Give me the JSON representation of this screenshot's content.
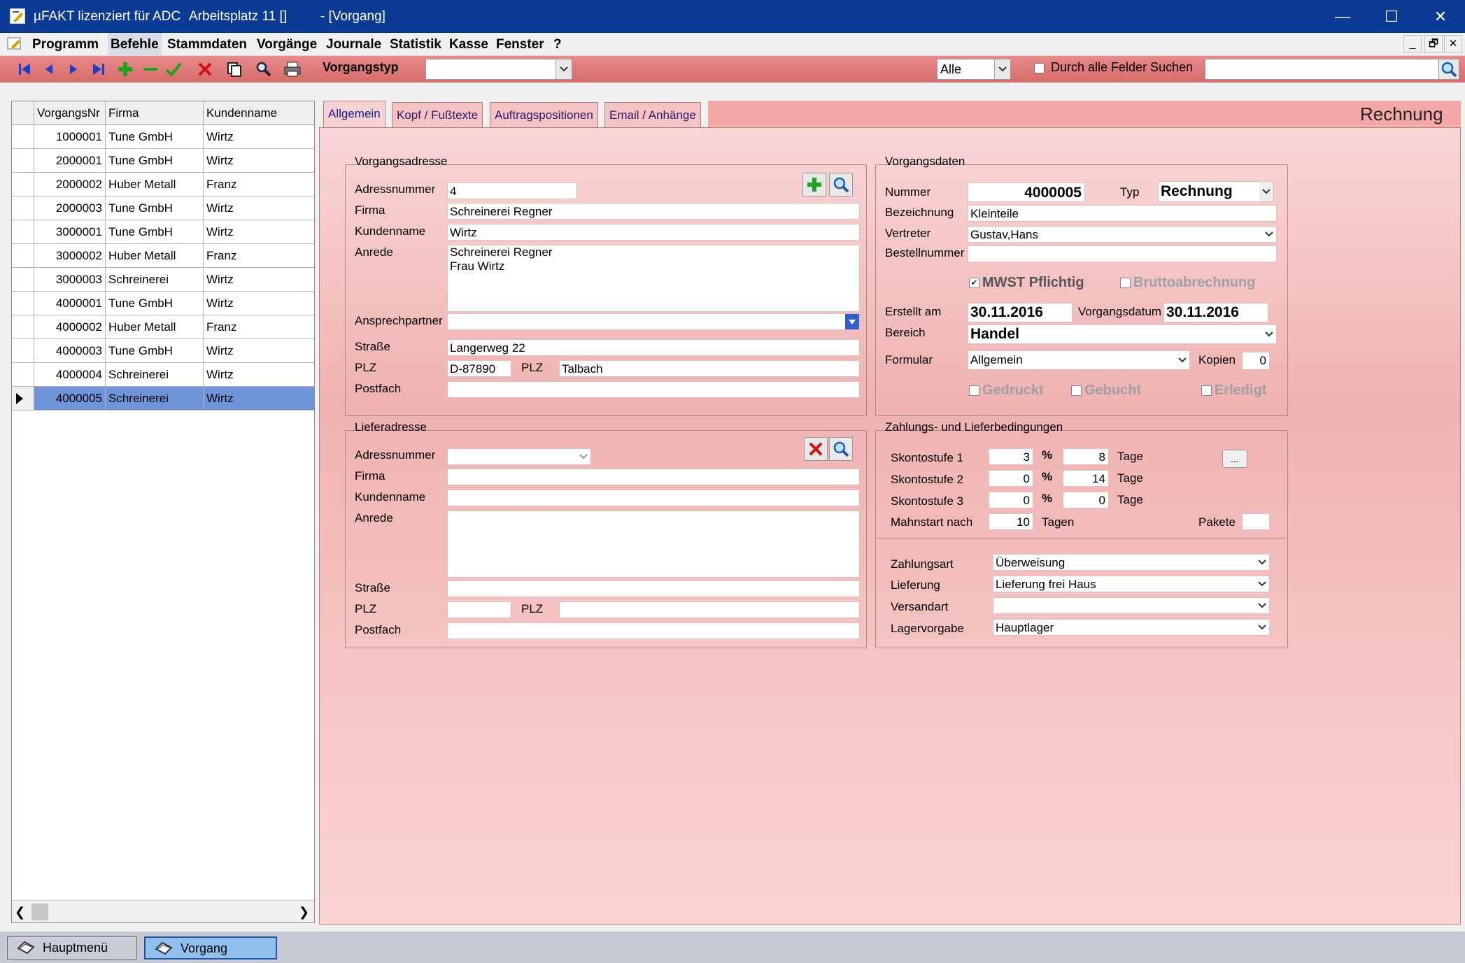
{
  "window": {
    "title": "µFAKT lizenziert für ADC",
    "workstation": "Arbeitsplatz 11 []",
    "doc": "- [Vorgang]",
    "minimize": "—",
    "maximize": "☐",
    "close": "✕"
  },
  "menu": [
    "Programm",
    "Befehle",
    "Stammdaten",
    "Vorgänge",
    "Journale",
    "Statistik",
    "Kasse",
    "Fenster",
    "?"
  ],
  "mdi": {
    "minimize": "_",
    "restore": "🗗",
    "close": "✕"
  },
  "toolbar": {
    "vorgangstyp_label": "Vorgangstyp",
    "vorgangstyp_value": "",
    "filter_value": "Alle",
    "search_all_label": "Durch alle Felder Suchen",
    "search_value": ""
  },
  "grid": {
    "columns": [
      "VorgangsNr",
      "Firma",
      "Kundenname"
    ],
    "rows": [
      {
        "nr": "1000001",
        "firma": "Tune GmbH",
        "kunde": "Wirtz"
      },
      {
        "nr": "2000001",
        "firma": "Tune GmbH",
        "kunde": "Wirtz"
      },
      {
        "nr": "2000002",
        "firma": "Huber Metall",
        "kunde": "Franz"
      },
      {
        "nr": "2000003",
        "firma": "Tune GmbH",
        "kunde": "Wirtz"
      },
      {
        "nr": "3000001",
        "firma": "Tune GmbH",
        "kunde": "Wirtz"
      },
      {
        "nr": "3000002",
        "firma": "Huber Metall",
        "kunde": "Franz"
      },
      {
        "nr": "3000003",
        "firma": "Schreinerei",
        "kunde": "Wirtz"
      },
      {
        "nr": "4000001",
        "firma": "Tune GmbH",
        "kunde": "Wirtz"
      },
      {
        "nr": "4000002",
        "firma": "Huber Metall",
        "kunde": "Franz"
      },
      {
        "nr": "4000003",
        "firma": "Tune GmbH",
        "kunde": "Wirtz"
      },
      {
        "nr": "4000004",
        "firma": "Schreinerei",
        "kunde": "Wirtz"
      },
      {
        "nr": "4000005",
        "firma": "Schreinerei",
        "kunde": "Wirtz"
      }
    ],
    "selected_index": 11
  },
  "tabs": [
    "Allgemein",
    "Kopf / Fußtexte",
    "Auftragspositionen",
    "Email / Anhänge"
  ],
  "doc_type_heading": "Rechnung",
  "vorgangsadresse": {
    "title": "Vorgangsadresse",
    "labels": {
      "adressnummer": "Adressnummer",
      "firma": "Firma",
      "kundenname": "Kundenname",
      "anrede": "Anrede",
      "ansprechpartner": "Ansprechpartner",
      "strasse": "Straße",
      "plz": "PLZ",
      "ort": "PLZ",
      "postfach": "Postfach"
    },
    "adressnummer": "4",
    "firma": "Schreinerei Regner",
    "kundenname": "Wirtz",
    "anrede_line1": "Schreinerei Regner",
    "anrede_line2": "Frau Wirtz",
    "ansprechpartner": "",
    "strasse": "Langerweg 22",
    "plz": "D-87890",
    "ort": "Talbach",
    "postfach": ""
  },
  "lieferadresse": {
    "title": "Lieferadresse",
    "labels": {
      "adressnummer": "Adressnummer",
      "firma": "Firma",
      "kundenname": "Kundenname",
      "anrede": "Anrede",
      "strasse": "Straße",
      "plz": "PLZ",
      "ort": "PLZ",
      "postfach": "Postfach"
    }
  },
  "vorgangsdaten": {
    "title": "Vorgangsdaten",
    "labels": {
      "nummer": "Nummer",
      "typ": "Typ",
      "bezeichnung": "Bezeichnung",
      "vertreter": "Vertreter",
      "bestellnummer": "Bestellnummer",
      "erstellt": "Erstellt am",
      "vorgangsdatum": "Vorgangsdatum",
      "bereich": "Bereich",
      "formular": "Formular",
      "kopien": "Kopien"
    },
    "nummer": "4000005",
    "typ": "Rechnung",
    "bezeichnung": "Kleinteile",
    "vertreter": "Gustav,Hans",
    "bestellnummer": "",
    "mwst_label": "MWST Pflichtig",
    "mwst_checked": "✔",
    "brutto_label": "Bruttoabrechnung",
    "erstellt_am": "30.11.2016",
    "vorgangsdatum": "30.11.2016",
    "bereich": "Handel",
    "formular": "Allgemein",
    "kopien": "0",
    "gedruckt_label": "Gedruckt",
    "gebucht_label": "Gebucht",
    "erledigt_label": "Erledigt"
  },
  "zahlung": {
    "title": "Zahlungs- und Lieferbedingungen",
    "skonto1_label": "Skontostufe 1",
    "skonto2_label": "Skontostufe 2",
    "skonto3_label": "Skontostufe 3",
    "percent": "%",
    "tage": "Tage",
    "skonto1_pct": "3",
    "skonto1_days": "8",
    "skonto2_pct": "0",
    "skonto2_days": "14",
    "skonto3_pct": "0",
    "skonto3_days": "0",
    "mahnstart_label": "Mahnstart nach",
    "mahnstart_value": "10",
    "tagen": "Tagen",
    "pakete_label": "Pakete",
    "pakete_value": "",
    "more_button": "...",
    "zahlungsart_label": "Zahlungsart",
    "zahlungsart": "Überweisung",
    "lieferung_label": "Lieferung",
    "lieferung": "Lieferung frei Haus",
    "versandart_label": "Versandart",
    "versandart": "",
    "lagervorgabe_label": "Lagervorgabe",
    "lagervorgabe": "Hauptlager"
  },
  "statusbar": {
    "hauptmenu": "Hauptmenü",
    "vorgang": "Vorgang"
  },
  "colors": {
    "titlebar": "#0c3b95",
    "panel": "#f4c0c0",
    "selected_row": "#6f93d8"
  }
}
